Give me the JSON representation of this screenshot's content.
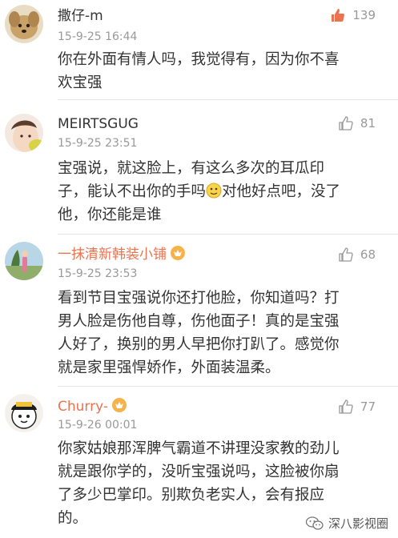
{
  "comments": [
    {
      "user": "撒仔-m",
      "time": "15-9-25 16:44",
      "likes": "139",
      "liked": true,
      "text": [
        "你在外面有情人吗，我觉得有，因为你不喜",
        "欢宝强"
      ]
    },
    {
      "user": "MEIRTSGUG",
      "time": "15-9-25 23:51",
      "likes": "81",
      "liked": false,
      "text_line1": "宝强说，就这脸上，有这么多次的耳瓜印",
      "text_line2_a": "子，能认不出你的手吗",
      "text_line2_b": "对他好点吧，没了",
      "text_line3": "他，你还能是谁"
    },
    {
      "user": "一抹清新韩装小铺",
      "time": "15-9-25 23:53",
      "likes": "68",
      "liked": false,
      "text": [
        "看到节目宝强说你还打他脸，你知道吗？打",
        "男人脸是伤他自尊，伤他面子！真的是宝强",
        "人好了，换别的男人早把你打趴了。感觉你",
        "就是家里强悍娇作，外面装温柔。"
      ]
    },
    {
      "user": "Churry-",
      "time": "15-9-26 00:01",
      "likes": "77",
      "liked": false,
      "text": [
        "你家姑娘那浑脾气霸道不讲理没家教的劲儿",
        "就是跟你学的，没听宝强说吗，这脸被你扇",
        "了多少巴掌印。别欺负老实人，会有报应",
        "的。"
      ]
    }
  ],
  "watermark": "深八影视圈",
  "colors": {
    "accent": "#eb7350",
    "muted": "#999999",
    "divider": "#e6e6e6"
  }
}
